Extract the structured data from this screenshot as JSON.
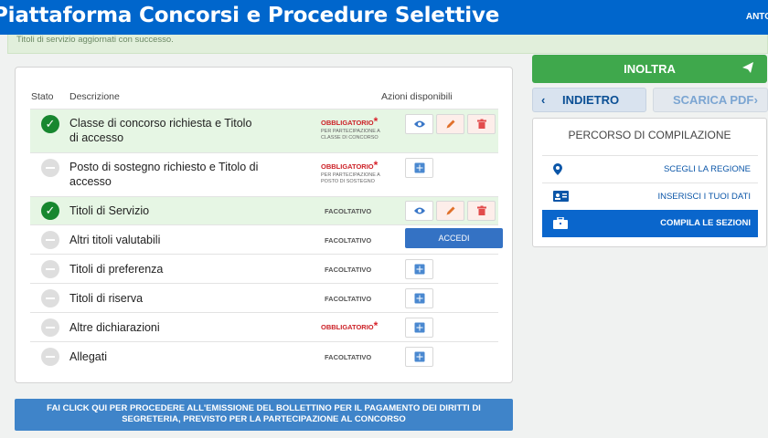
{
  "header": {
    "title": "Piattaforma Concorsi e Procedure Selettive",
    "user": "ANTO"
  },
  "alert": {
    "message": "Titoli di servizio aggiornati con successo."
  },
  "table": {
    "headers": {
      "stato": "Stato",
      "descrizione": "Descrizione",
      "azioni": "Azioni disponibili"
    },
    "rows": [
      {
        "desc": "Classe di concorso richiesta e Titolo di accesso",
        "status": "complete",
        "badge": "OBBLIGATORIO",
        "note": "PER PARTECIPAZIONE A CLASSE DI CONCORSO"
      },
      {
        "desc": "Posto di sostegno richiesto e Titolo di accesso",
        "status": "empty",
        "badge": "OBBLIGATORIO",
        "note": "PER PARTECIPAZIONE A POSTO DI SOSTEGNO"
      },
      {
        "desc": "Titoli di Servizio",
        "status": "complete",
        "badge": "FACOLTATIVO"
      },
      {
        "desc": "Altri titoli valutabili",
        "status": "empty",
        "badge": "FACOLTATIVO",
        "action": "ACCEDI"
      },
      {
        "desc": "Titoli di preferenza",
        "status": "empty",
        "badge": "FACOLTATIVO"
      },
      {
        "desc": "Titoli di riserva",
        "status": "empty",
        "badge": "FACOLTATIVO"
      },
      {
        "desc": "Altre dichiarazioni",
        "status": "empty",
        "badge": "OBBLIGATORIO"
      },
      {
        "desc": "Allegati",
        "status": "empty",
        "badge": "FACOLTATIVO"
      }
    ],
    "star": "*"
  },
  "payment_button": {
    "line1": "FAI CLICK QUI PER PROCEDERE ALL'EMISSIONE DEL BOLLETTINO PER IL PAGAMENTO DEI DIRITTI DI",
    "line2": "SEGRETERIA, PREVISTO PER LA PARTECIPAZIONE AL CONCORSO"
  },
  "actions": {
    "inoltra": "INOLTRA",
    "indietro": "INDIETRO",
    "scarica_pdf": "SCARICA PDF"
  },
  "percorso": {
    "title": "PERCORSO DI COMPILAZIONE",
    "steps": [
      {
        "label": "SCEGLI LA REGIONE",
        "icon": "map-pin-icon"
      },
      {
        "label": "INSERISCI I TUOI DATI",
        "icon": "id-card-icon"
      },
      {
        "label": "COMPILA LE SEZIONI",
        "icon": "briefcase-icon",
        "active": true
      }
    ]
  },
  "colors": {
    "header": "#0066cc",
    "success": "#17872f",
    "mandatory": "#cc2127",
    "inoltra": "#3fa84c",
    "active_step": "#0a66cc"
  }
}
